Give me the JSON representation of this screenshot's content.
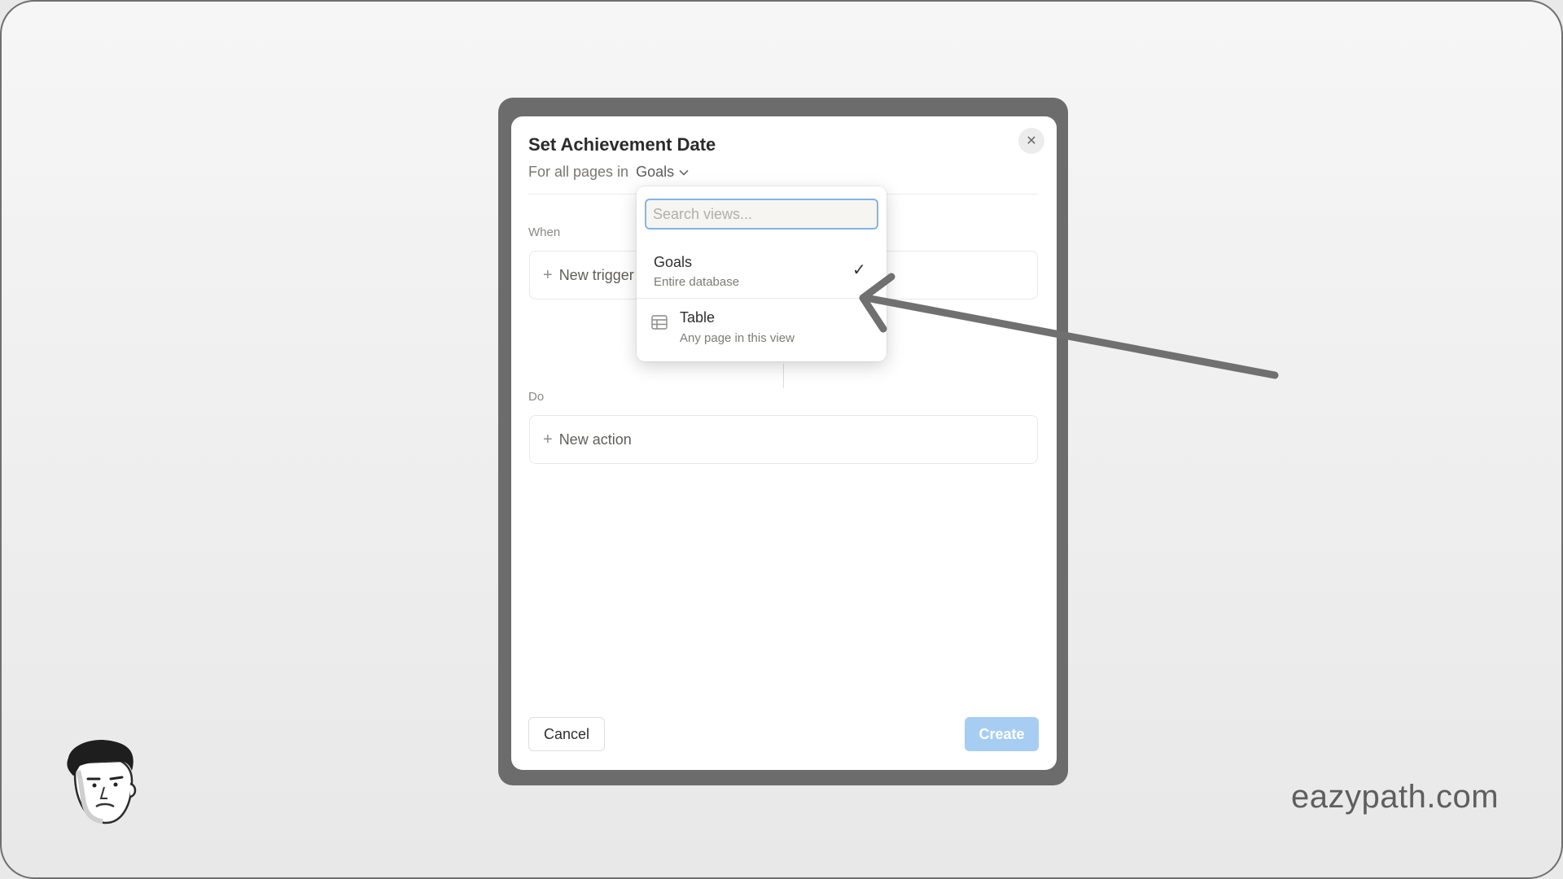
{
  "modal": {
    "title": "Set Achievement Date",
    "subtitle_prefix": "For all pages in",
    "database_selected": "Goals",
    "when_label": "When",
    "trigger_label": "New trigger",
    "do_label": "Do",
    "action_label": "New action",
    "cancel_label": "Cancel",
    "create_label": "Create"
  },
  "dropdown": {
    "search_placeholder": "Search views...",
    "options": [
      {
        "name": "Goals",
        "description": "Entire database",
        "selected": true
      },
      {
        "name": "Table",
        "description": "Any page in this view",
        "icon": "table-icon",
        "selected": false
      }
    ]
  },
  "watermark": "eazypath.com",
  "colors": {
    "accent_focus": "#84b3e6",
    "create_disabled": "#a8cdf3",
    "frame": "#6c6c6c"
  }
}
